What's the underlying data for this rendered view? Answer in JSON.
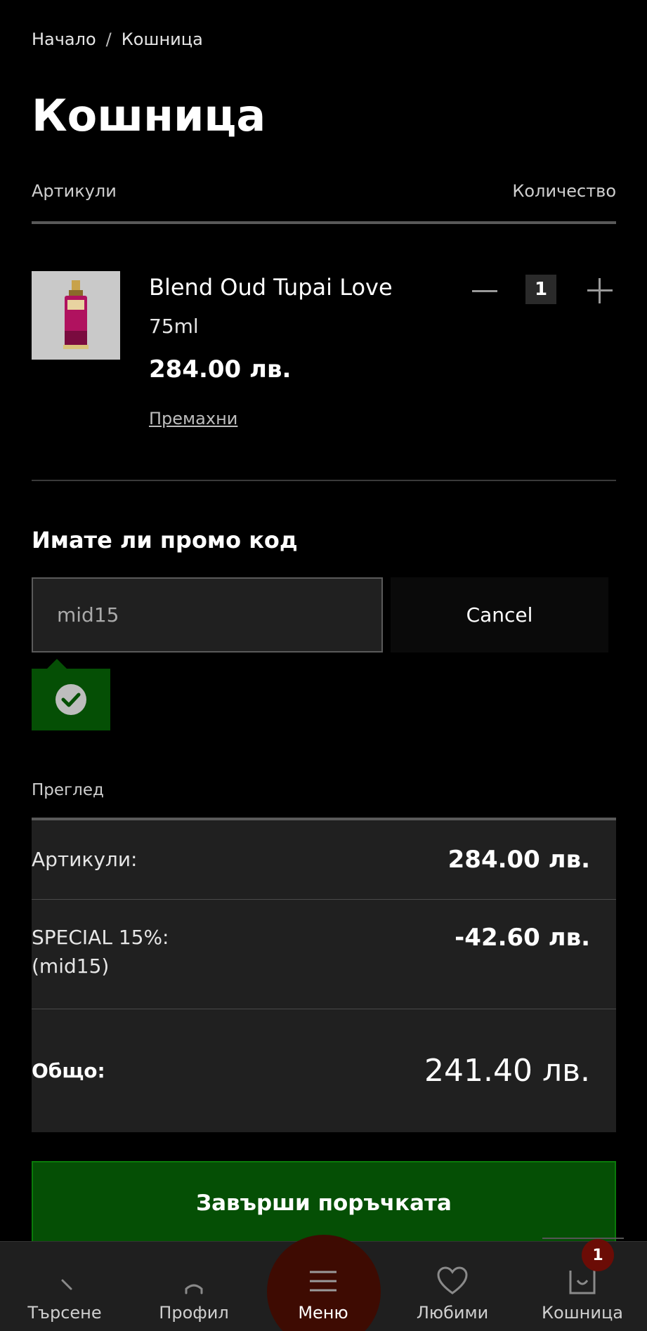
{
  "breadcrumb": {
    "home": "Начало",
    "separator": "/",
    "current": "Кошница"
  },
  "page": {
    "title": "Кошница"
  },
  "cart_header": {
    "items_label": "Артикули",
    "quantity_label": "Количество"
  },
  "product": {
    "name": "Blend Oud Tupai Love",
    "size": "75ml",
    "price": "284.00 лв.",
    "remove_label": "Премахни",
    "quantity": "1",
    "image_icon": "perfume-bottle"
  },
  "promo": {
    "title": "Имате ли промо код",
    "code_value": "mid15",
    "cancel_label": "Cancel",
    "status_icon": "check-circle",
    "status_color": "#054f05"
  },
  "summary": {
    "label": "Преглед",
    "items_key": "Артикули:",
    "items_value": "284.00 лв.",
    "discount_key_line1": "SPECIAL 15%:",
    "discount_key_line2": "(mid15)",
    "discount_value": "-42.60 лв.",
    "total_key": "Общо:",
    "total_value": "241.40 лв."
  },
  "checkout": {
    "label": "Завърши поръчката",
    "color": "#054f05"
  },
  "bottom_nav": {
    "items": [
      {
        "label": "Търсене",
        "icon": "search-icon"
      },
      {
        "label": "Профил",
        "icon": "user-icon"
      },
      {
        "label": "Меню",
        "icon": "menu-icon"
      },
      {
        "label": "Любими",
        "icon": "heart-icon"
      },
      {
        "label": "Кошница",
        "icon": "cart-icon"
      }
    ],
    "cart_badge": "1",
    "menu_highlight_color": "#3e0b02"
  }
}
